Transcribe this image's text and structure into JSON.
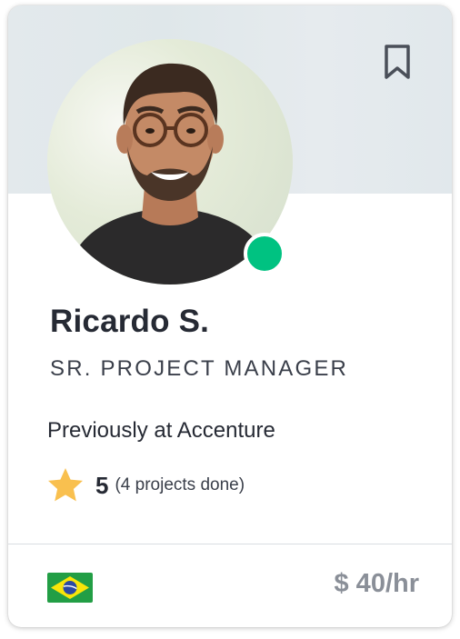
{
  "profile": {
    "name": "Ricardo S.",
    "title": "SR. PROJECT MANAGER",
    "previously": "Previously at Accenture",
    "online": true,
    "rating": {
      "value": "5",
      "detail": "(4 projects done)"
    },
    "country_flag": "brazil-flag",
    "rate": "$ 40/hr"
  },
  "icons": {
    "bookmark": "bookmark-icon",
    "star": "star-icon"
  },
  "colors": {
    "status_online": "#00c281",
    "star": "#f9c04f",
    "banner": "#e3e9ec"
  }
}
